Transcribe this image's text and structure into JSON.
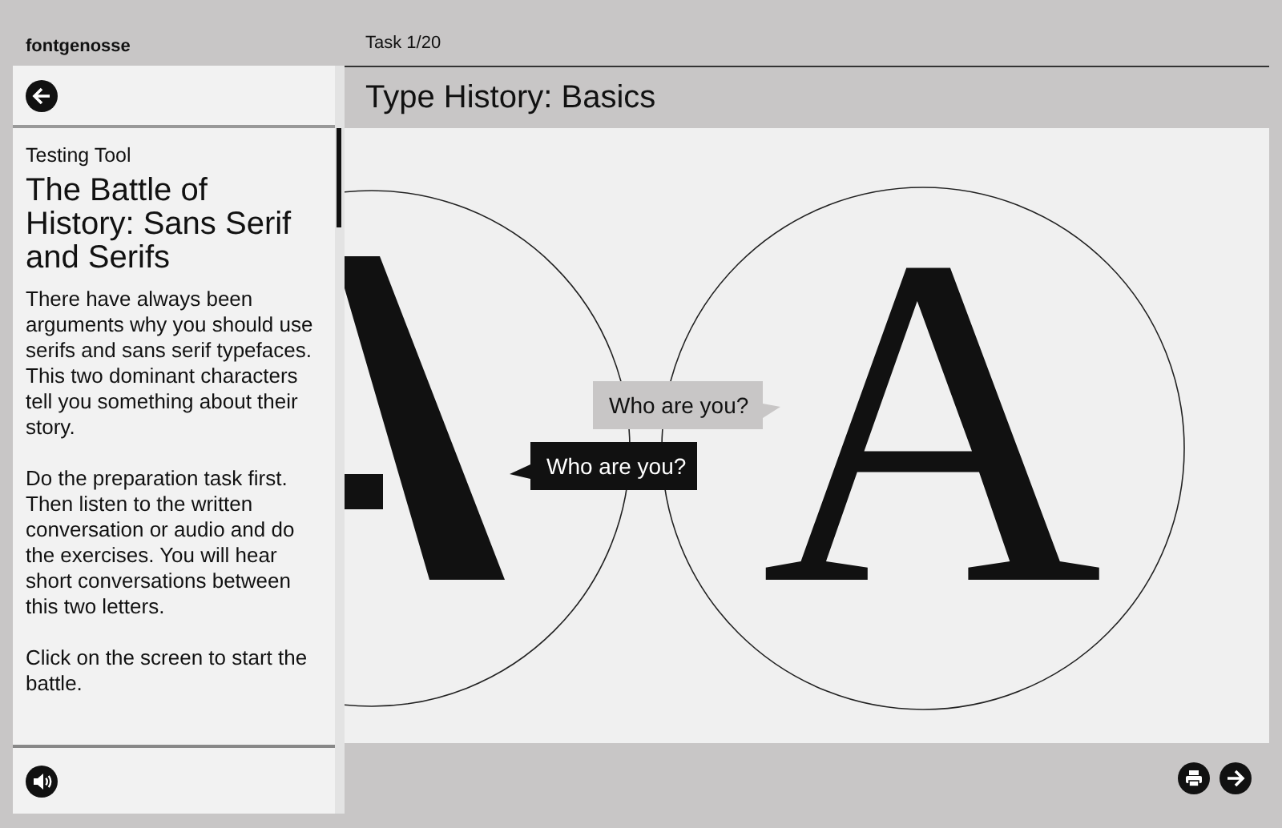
{
  "brand": "fontgenosse",
  "task_counter": "Task 1/20",
  "title": "Type History: Basics",
  "sidebar": {
    "eyebrow": "Testing Tool",
    "heading": "The Battle of History: Sans Serif and Serifs",
    "paragraphs": [
      "There have always been arguments why you should use serifs and sans serif typefaces. This two dominant characters tell you something about their story.",
      "Do the preparation task first. Then listen to the written conversation or audio and do the exercises. You will hear short conversations between this two letters.",
      "Click on the screen to start the battle."
    ]
  },
  "canvas": {
    "letters": [
      {
        "kind": "sans"
      },
      {
        "char": "A",
        "kind": "serif"
      }
    ],
    "bubbles": [
      {
        "text": "Who are you?",
        "kind": "light"
      },
      {
        "text": "Who are you?",
        "kind": "dark"
      }
    ]
  },
  "footer_buttons": [
    {
      "kind": "print"
    },
    {
      "kind": "next"
    }
  ]
}
